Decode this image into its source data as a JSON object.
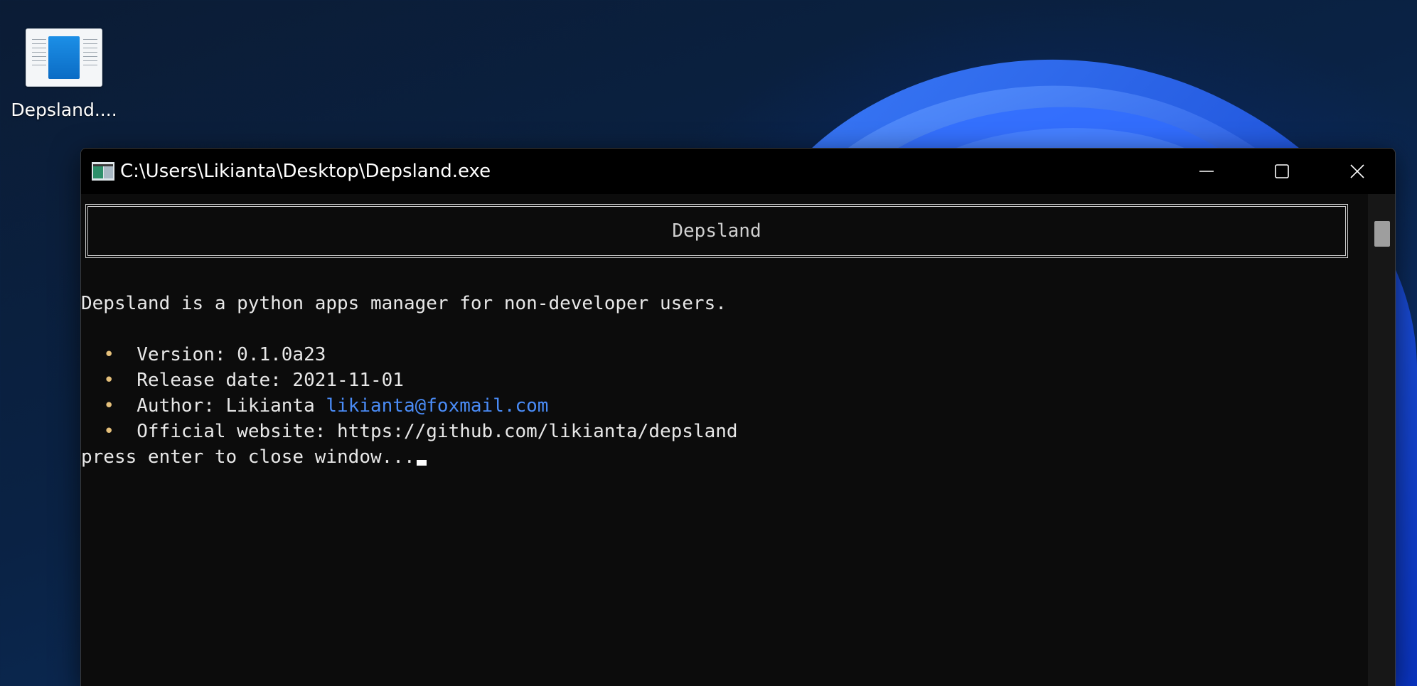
{
  "desktop": {
    "icon_label": "Depsland...."
  },
  "window": {
    "title": "C:\\Users\\Likianta\\Desktop\\Depsland.exe"
  },
  "console": {
    "banner": "Depsland",
    "description": "Depsland is a python apps manager for non-developer users.",
    "items": [
      {
        "bullet": "•",
        "text": "Version: 0.1.0a23"
      },
      {
        "bullet": "•",
        "text": "Release date: 2021-11-01"
      },
      {
        "bullet": "•",
        "text": "Author: Likianta ",
        "link": "likianta@foxmail.com"
      },
      {
        "bullet": "•",
        "text": "Official website: https://github.com/likianta/depsland"
      }
    ],
    "prompt": "press enter to close window..."
  },
  "colors": {
    "accent_link": "#4a8cf7",
    "bullet": "#e5c07b",
    "console_bg": "#0c0c0c"
  }
}
